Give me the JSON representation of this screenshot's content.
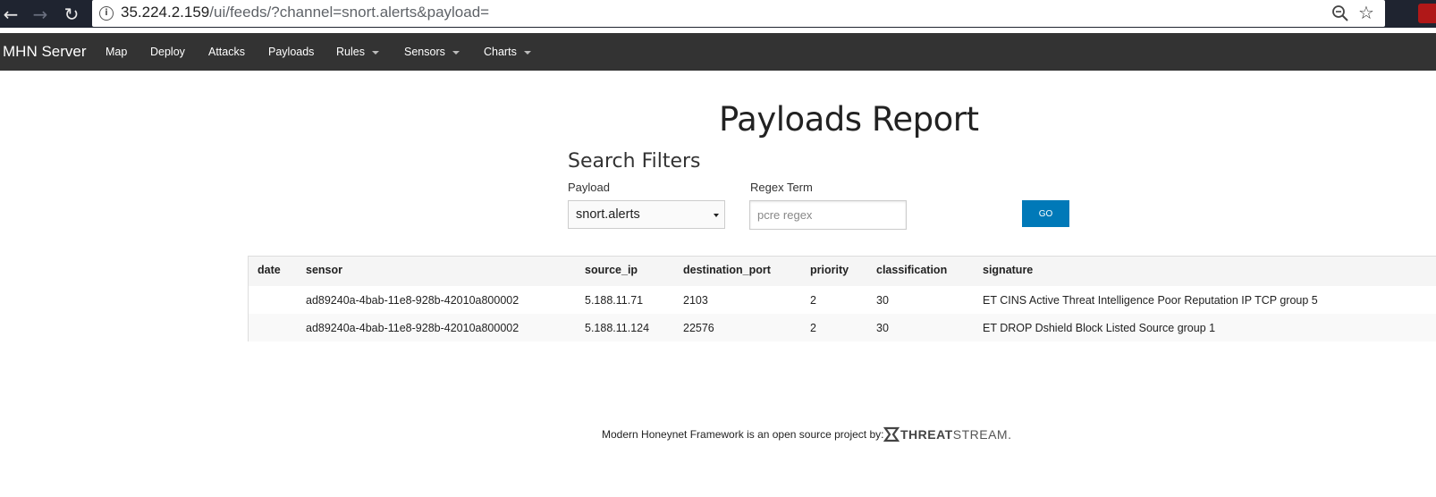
{
  "browser": {
    "url_host": "35.224.2.159",
    "url_path": "/ui/feeds/?channel=snort.alerts&payload=",
    "icons": [
      "back-arrow-icon",
      "forward-arrow-icon",
      "reload-icon",
      "info-icon",
      "zoom-out-icon",
      "star-icon"
    ]
  },
  "navbar": {
    "brand": "MHN Server",
    "items": [
      {
        "label": "Map"
      },
      {
        "label": "Deploy"
      },
      {
        "label": "Attacks"
      },
      {
        "label": "Payloads"
      },
      {
        "label": "Rules"
      },
      {
        "label": "Sensors"
      },
      {
        "label": "Charts"
      }
    ]
  },
  "main": {
    "title": "Payloads Report",
    "filters": {
      "heading": "Search Filters",
      "payload_label": "Payload",
      "payload_value": "snort.alerts",
      "regex_label": "Regex Term",
      "regex_placeholder": "pcre regex",
      "go_label": "GO"
    },
    "table": {
      "headers": [
        "date",
        "sensor",
        "source_ip",
        "destination_port",
        "priority",
        "classification",
        "signature"
      ],
      "rows": [
        [
          "",
          "ad89240a-4bab-11e8-928b-42010a800002",
          "5.188.11.71",
          "2103",
          "2",
          "30",
          "ET CINS Active Threat Intelligence Poor Reputation IP TCP group 5"
        ],
        [
          "",
          "ad89240a-4bab-11e8-928b-42010a800002",
          "5.188.11.124",
          "22576",
          "2",
          "30",
          "ET DROP Dshield Block Listed Source group 1"
        ]
      ]
    }
  },
  "footer": {
    "text": "Modern Honeynet Framework is an open source project by:",
    "logo_bold": "THREAT",
    "logo_light": "STREAM."
  },
  "colors": {
    "navbar_bg": "#333333",
    "go_button": "#0079b8",
    "browser_chrome": "#1f2430"
  }
}
